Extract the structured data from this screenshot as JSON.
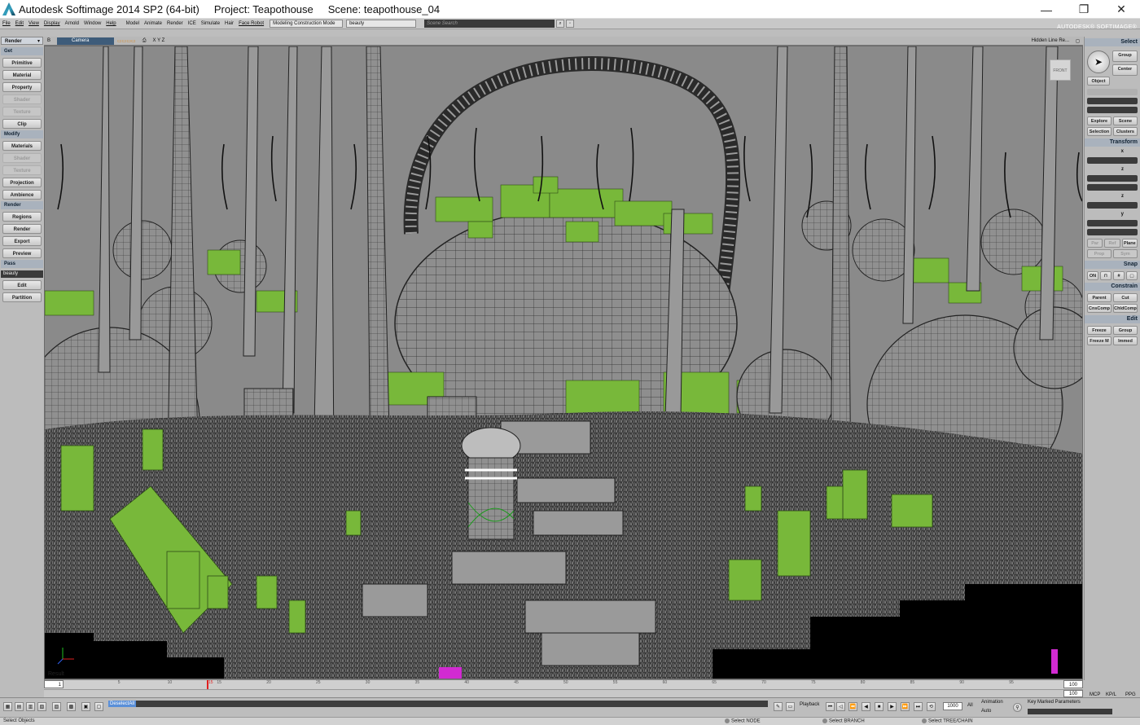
{
  "window": {
    "title": "Autodesk Softimage 2014 SP2 (64-bit)",
    "project": "Project: Teapothouse",
    "scene": "Scene: teapothouse_04",
    "controls": [
      "—",
      "❐",
      "✕"
    ]
  },
  "menu": {
    "items": [
      "File",
      "Edit",
      "View",
      "Display",
      "Arnold",
      "Window",
      "Help",
      "Model",
      "Animate",
      "Render",
      "ICE",
      "Simulate",
      "Hair",
      "Face Robot"
    ],
    "mode": "Modeling Construction Mode",
    "pass": "beauty",
    "search_placeholder": "Scene Search",
    "brand": "AUTODESK® SOFTIMAGE®"
  },
  "left_panel": {
    "module": "Render",
    "sections": [
      {
        "title": "Get",
        "buttons": [
          {
            "label": "Primitive",
            "enabled": true
          },
          {
            "label": "Material",
            "enabled": true
          },
          {
            "label": "Property",
            "enabled": true
          },
          {
            "label": "Shader",
            "enabled": false
          },
          {
            "label": "Texture",
            "enabled": false
          },
          {
            "label": "Clip",
            "enabled": true
          }
        ]
      },
      {
        "title": "Modify",
        "buttons": [
          {
            "label": "Materials",
            "enabled": true
          },
          {
            "label": "Shader",
            "enabled": false
          },
          {
            "label": "Texture",
            "enabled": false
          },
          {
            "label": "Projection",
            "enabled": true
          },
          {
            "label": "Ambience",
            "enabled": true
          }
        ]
      },
      {
        "title": "Render",
        "buttons": [
          {
            "label": "Regions",
            "enabled": true
          },
          {
            "label": "Render",
            "enabled": true
          },
          {
            "label": "Export",
            "enabled": true
          },
          {
            "label": "Preview",
            "enabled": true
          }
        ]
      },
      {
        "title": "Pass",
        "pass_value": "beauty",
        "buttons": [
          {
            "label": "Edit",
            "enabled": true
          },
          {
            "label": "Partition",
            "enabled": true
          }
        ]
      }
    ]
  },
  "viewport": {
    "camera": "Camera",
    "axes_text": "X Y Z",
    "display_mode": "Hidden Line Re...",
    "nav_cube": "FRONT",
    "result_label": "Result",
    "colors": {
      "background": "#8a8a8a",
      "wireframe": "#2a2a2a",
      "foliage": "#78b83a"
    }
  },
  "right_panel": {
    "select": {
      "title": "Select",
      "group": "Group",
      "center": "Center",
      "object": "Object",
      "explore": "Explore",
      "scene": "Scene",
      "selection": "Selection",
      "clusters": "Clusters"
    },
    "transform": {
      "title": "Transform",
      "rows": [
        "x",
        "z",
        "z",
        "y"
      ],
      "par": "Par",
      "ref": "Ref",
      "plane": "Plane",
      "prop": "Prop",
      "sym": "Sym"
    },
    "snap": {
      "title": "Snap",
      "on": "ON"
    },
    "constrain": {
      "title": "Constrain",
      "parent": "Parent",
      "cut": "Cut",
      "cnscomp": "CnsComp",
      "chldcomp": "ChldComp"
    },
    "edit": {
      "title": "Edit",
      "freeze": "Freeze",
      "group": "Group",
      "freeze_m": "Freeze M",
      "immed": "Immed"
    }
  },
  "timeline": {
    "start": "1",
    "end": "100",
    "end2": "100",
    "current": "15",
    "ticks": [
      "5",
      "10",
      "15",
      "20",
      "25",
      "30",
      "35",
      "40",
      "45",
      "50",
      "55",
      "60",
      "65",
      "70",
      "75",
      "80",
      "85",
      "90",
      "95"
    ]
  },
  "bottom": {
    "command": "DeselectAll",
    "playback": "Playback",
    "frame": "1000",
    "all": "All",
    "animation": "Animation",
    "auto": "Auto",
    "key_marked": "Key Marked Parameters",
    "mcp": "MCP",
    "kpl": "KP/L",
    "ppg": "PPG"
  },
  "status": {
    "left": "Select Objects",
    "node": "Select NODE",
    "branch": "Select BRANCH",
    "tree": "Select TREE/CHAIN"
  }
}
